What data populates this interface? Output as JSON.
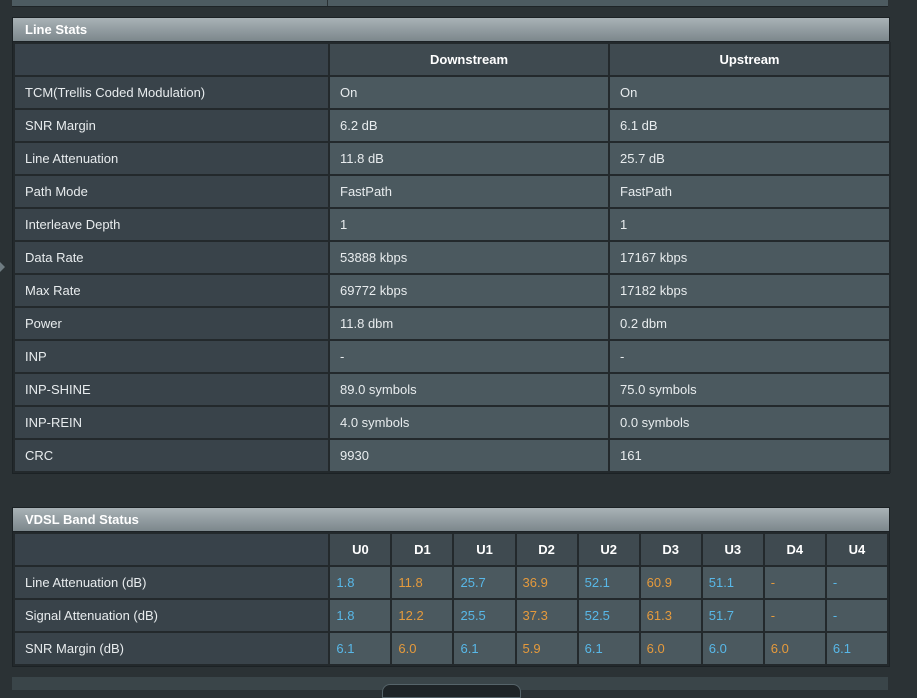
{
  "line_stats": {
    "title": "Line Stats",
    "columns": [
      "Downstream",
      "Upstream"
    ],
    "rows": [
      {
        "label": "TCM(Trellis Coded Modulation)",
        "down": "On",
        "up": "On"
      },
      {
        "label": "SNR Margin",
        "down": "6.2 dB",
        "up": "6.1 dB"
      },
      {
        "label": "Line Attenuation",
        "down": "11.8 dB",
        "up": "25.7 dB"
      },
      {
        "label": "Path Mode",
        "down": "FastPath",
        "up": "FastPath"
      },
      {
        "label": "Interleave Depth",
        "down": "1",
        "up": "1"
      },
      {
        "label": "Data Rate",
        "down": "53888 kbps",
        "up": "17167 kbps"
      },
      {
        "label": "Max Rate",
        "down": "69772 kbps",
        "up": "17182 kbps"
      },
      {
        "label": "Power",
        "down": "11.8 dbm",
        "up": "0.2 dbm"
      },
      {
        "label": "INP",
        "down": "-",
        "up": "-"
      },
      {
        "label": "INP-SHINE",
        "down": "89.0 symbols",
        "up": "75.0 symbols"
      },
      {
        "label": "INP-REIN",
        "down": "4.0 symbols",
        "up": "0.0 symbols"
      },
      {
        "label": "CRC",
        "down": "9930",
        "up": "161"
      }
    ]
  },
  "vdsl_band": {
    "title": "VDSL Band Status",
    "bands": [
      "U0",
      "D1",
      "U1",
      "D2",
      "U2",
      "D3",
      "U3",
      "D4",
      "U4"
    ],
    "rows": [
      {
        "label": "Line Attenuation (dB)",
        "values": [
          "1.8",
          "11.8",
          "25.7",
          "36.9",
          "52.1",
          "60.9",
          "51.1",
          "-",
          "-"
        ]
      },
      {
        "label": "Signal Attenuation (dB)",
        "values": [
          "1.8",
          "12.2",
          "25.5",
          "37.3",
          "52.5",
          "61.3",
          "51.7",
          "-",
          "-"
        ]
      },
      {
        "label": "SNR Margin (dB)",
        "values": [
          "6.1",
          "6.0",
          "6.1",
          "5.9",
          "6.1",
          "6.0",
          "6.0",
          "6.0",
          "6.1"
        ]
      }
    ]
  },
  "colors": {
    "upstream_value": "#58b8e8",
    "downstream_value": "#e59a3c"
  }
}
